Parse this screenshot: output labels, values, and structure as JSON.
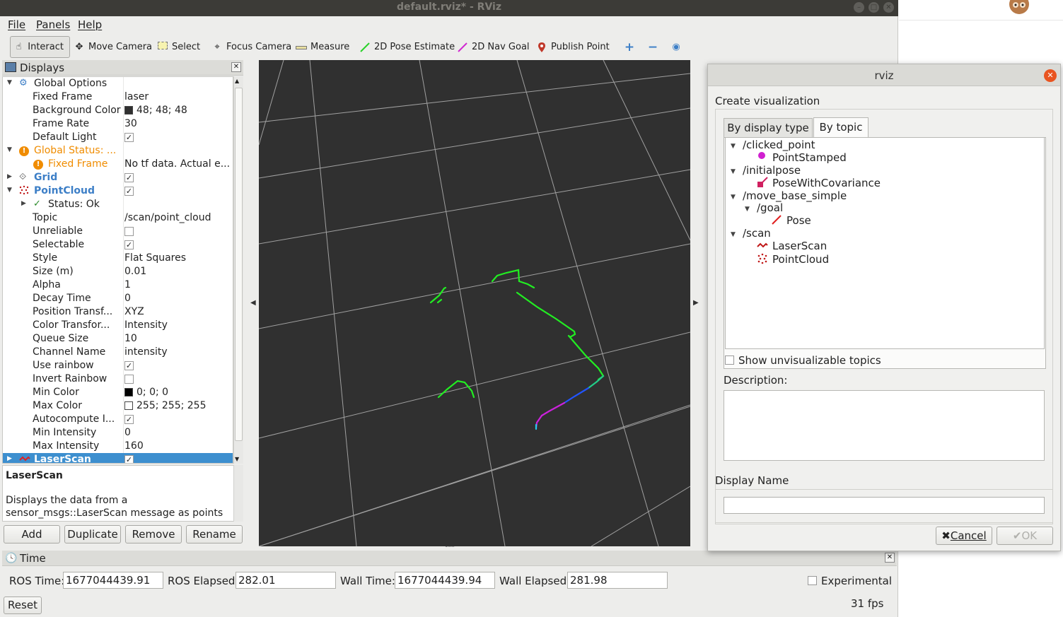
{
  "window": {
    "title": "default.rviz* - RViz"
  },
  "menu": [
    "File",
    "Panels",
    "Help"
  ],
  "toolbar": {
    "tools": [
      {
        "label": "Interact",
        "icon": "hand-icon"
      },
      {
        "label": "Move Camera",
        "icon": "move-camera-icon"
      },
      {
        "label": "Select",
        "icon": "select-icon"
      },
      {
        "label": "Focus Camera",
        "icon": "focus-camera-icon"
      },
      {
        "label": "Measure",
        "icon": "ruler-icon"
      },
      {
        "label": "2D Pose Estimate",
        "icon": "pose-estimate-icon"
      },
      {
        "label": "2D Nav Goal",
        "icon": "nav-goal-icon"
      },
      {
        "label": "Publish Point",
        "icon": "map-pin-icon"
      }
    ],
    "extra_icons": [
      "plus-icon",
      "minus-icon",
      "eye-icon"
    ]
  },
  "displays": {
    "title": "Displays",
    "rows": [
      {
        "name": "Global Options",
        "value": ""
      },
      {
        "name": "Fixed Frame",
        "value": "laser"
      },
      {
        "name": "Background Color",
        "value": "48; 48; 48"
      },
      {
        "name": "Frame Rate",
        "value": "30"
      },
      {
        "name": "Default Light",
        "value": ""
      },
      {
        "name": "Global Status: ...",
        "value": ""
      },
      {
        "name": "Fixed Frame",
        "value": "No tf data.  Actual e..."
      },
      {
        "name": "Grid",
        "value": ""
      },
      {
        "name": "PointCloud",
        "value": ""
      },
      {
        "name": "Status: Ok",
        "value": ""
      },
      {
        "name": "Topic",
        "value": "/scan/point_cloud"
      },
      {
        "name": "Unreliable",
        "value": ""
      },
      {
        "name": "Selectable",
        "value": ""
      },
      {
        "name": "Style",
        "value": "Flat Squares"
      },
      {
        "name": "Size (m)",
        "value": "0.01"
      },
      {
        "name": "Alpha",
        "value": "1"
      },
      {
        "name": "Decay Time",
        "value": "0"
      },
      {
        "name": "Position Transf...",
        "value": "XYZ"
      },
      {
        "name": "Color Transfor...",
        "value": "Intensity"
      },
      {
        "name": "Queue Size",
        "value": "10"
      },
      {
        "name": "Channel Name",
        "value": "intensity"
      },
      {
        "name": "Use rainbow",
        "value": ""
      },
      {
        "name": "Invert Rainbow",
        "value": ""
      },
      {
        "name": "Min Color",
        "value": "0; 0; 0"
      },
      {
        "name": "Max Color",
        "value": "255; 255; 255"
      },
      {
        "name": "Autocompute I...",
        "value": ""
      },
      {
        "name": "Min Intensity",
        "value": "0"
      },
      {
        "name": "Max Intensity",
        "value": "160"
      },
      {
        "name": "LaserScan",
        "value": ""
      }
    ],
    "description_title": "LaserScan",
    "description_text": "Displays the data from a sensor_msgs::LaserScan message as points in the world, drawn as points, billboards, or cubes.",
    "buttons": [
      "Add",
      "Duplicate",
      "Remove",
      "Rename"
    ]
  },
  "time": {
    "title": "Time",
    "ros_time_label": "ROS Time:",
    "ros_time": "1677044439.91",
    "ros_elapsed_label": "ROS Elapsed:",
    "ros_elapsed": "282.01",
    "wall_time_label": "Wall Time:",
    "wall_time": "1677044439.94",
    "wall_elapsed_label": "Wall Elapsed:",
    "wall_elapsed": "281.98",
    "experimental_label": "Experimental",
    "reset_label": "Reset",
    "fps": "31 fps"
  },
  "dialog": {
    "title": "rviz",
    "create_label": "Create visualization",
    "tabs": [
      "By display type",
      "By topic"
    ],
    "topics": [
      {
        "label": "/clicked_point",
        "level": 0
      },
      {
        "label": "PointStamped",
        "level": 1
      },
      {
        "label": "/initialpose",
        "level": 0
      },
      {
        "label": "PoseWithCovariance",
        "level": 1
      },
      {
        "label": "/move_base_simple",
        "level": 0
      },
      {
        "label": "/goal",
        "level": 1
      },
      {
        "label": "Pose",
        "level": 2
      },
      {
        "label": "/scan",
        "level": 0
      },
      {
        "label": "LaserScan",
        "level": 1
      },
      {
        "label": "PointCloud",
        "level": 1
      }
    ],
    "show_unvisualizable": "Show unvisualizable topics",
    "description_label": "Description:",
    "display_name_label": "Display Name",
    "cancel_label": "Cancel",
    "ok_label": "OK"
  },
  "colors": {
    "viewport_bg": "#303030",
    "selection": "#3d8fcf",
    "warning": "#f08c00",
    "link_blue": "#3d7fc7",
    "scan_green": "#00ff00"
  }
}
